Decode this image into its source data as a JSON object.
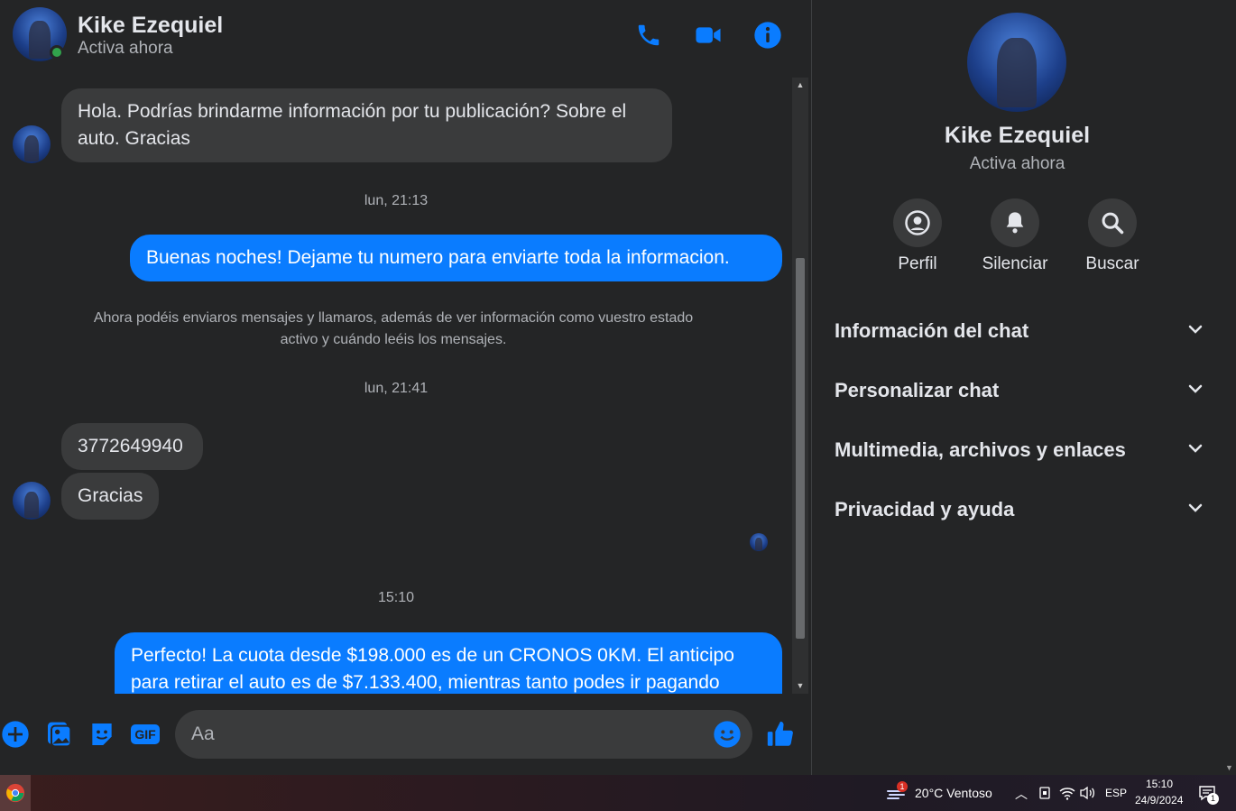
{
  "header": {
    "name": "Kike Ezequiel",
    "status": "Activa ahora"
  },
  "messages": {
    "msg1": "Hola. Podrías brindarme información por tu publicación? Sobre el auto. Gracias",
    "time1": "lun, 21:13",
    "msg2": "Buenas noches! Dejame tu numero para enviarte toda la informacion.",
    "system_note": "Ahora podéis enviaros mensajes y llamaros, además de ver información como vuestro estado activo y cuándo leéis los mensajes.",
    "time2": "lun, 21:41",
    "msg3": "3772649940",
    "msg4": "Gracias",
    "time3": "15:10",
    "msg5": "Perfecto! La cuota desde $198.000 es de un CRONOS 0KM. El anticipo para retirar el auto es de $7.133.400, mientras tanto podes ir pagando"
  },
  "composer": {
    "placeholder": "Aa",
    "gif_label": "GIF"
  },
  "panel": {
    "name": "Kike Ezequiel",
    "status": "Activa ahora",
    "actions": [
      {
        "label": "Perfil"
      },
      {
        "label": "Silenciar"
      },
      {
        "label": "Buscar"
      }
    ],
    "sections": [
      {
        "label": "Información del chat"
      },
      {
        "label": "Personalizar chat"
      },
      {
        "label": "Multimedia, archivos y enlaces"
      },
      {
        "label": "Privacidad y ayuda"
      }
    ]
  },
  "taskbar": {
    "weather": "20°C  Ventoso",
    "weather_badge": "1",
    "language": "ESP",
    "time": "15:10",
    "date": "24/9/2024",
    "notification_count": "1"
  },
  "colors": {
    "accent": "#0a7cff",
    "background": "#242526",
    "incoming_bubble": "#3a3b3c",
    "online": "#31a24c"
  }
}
